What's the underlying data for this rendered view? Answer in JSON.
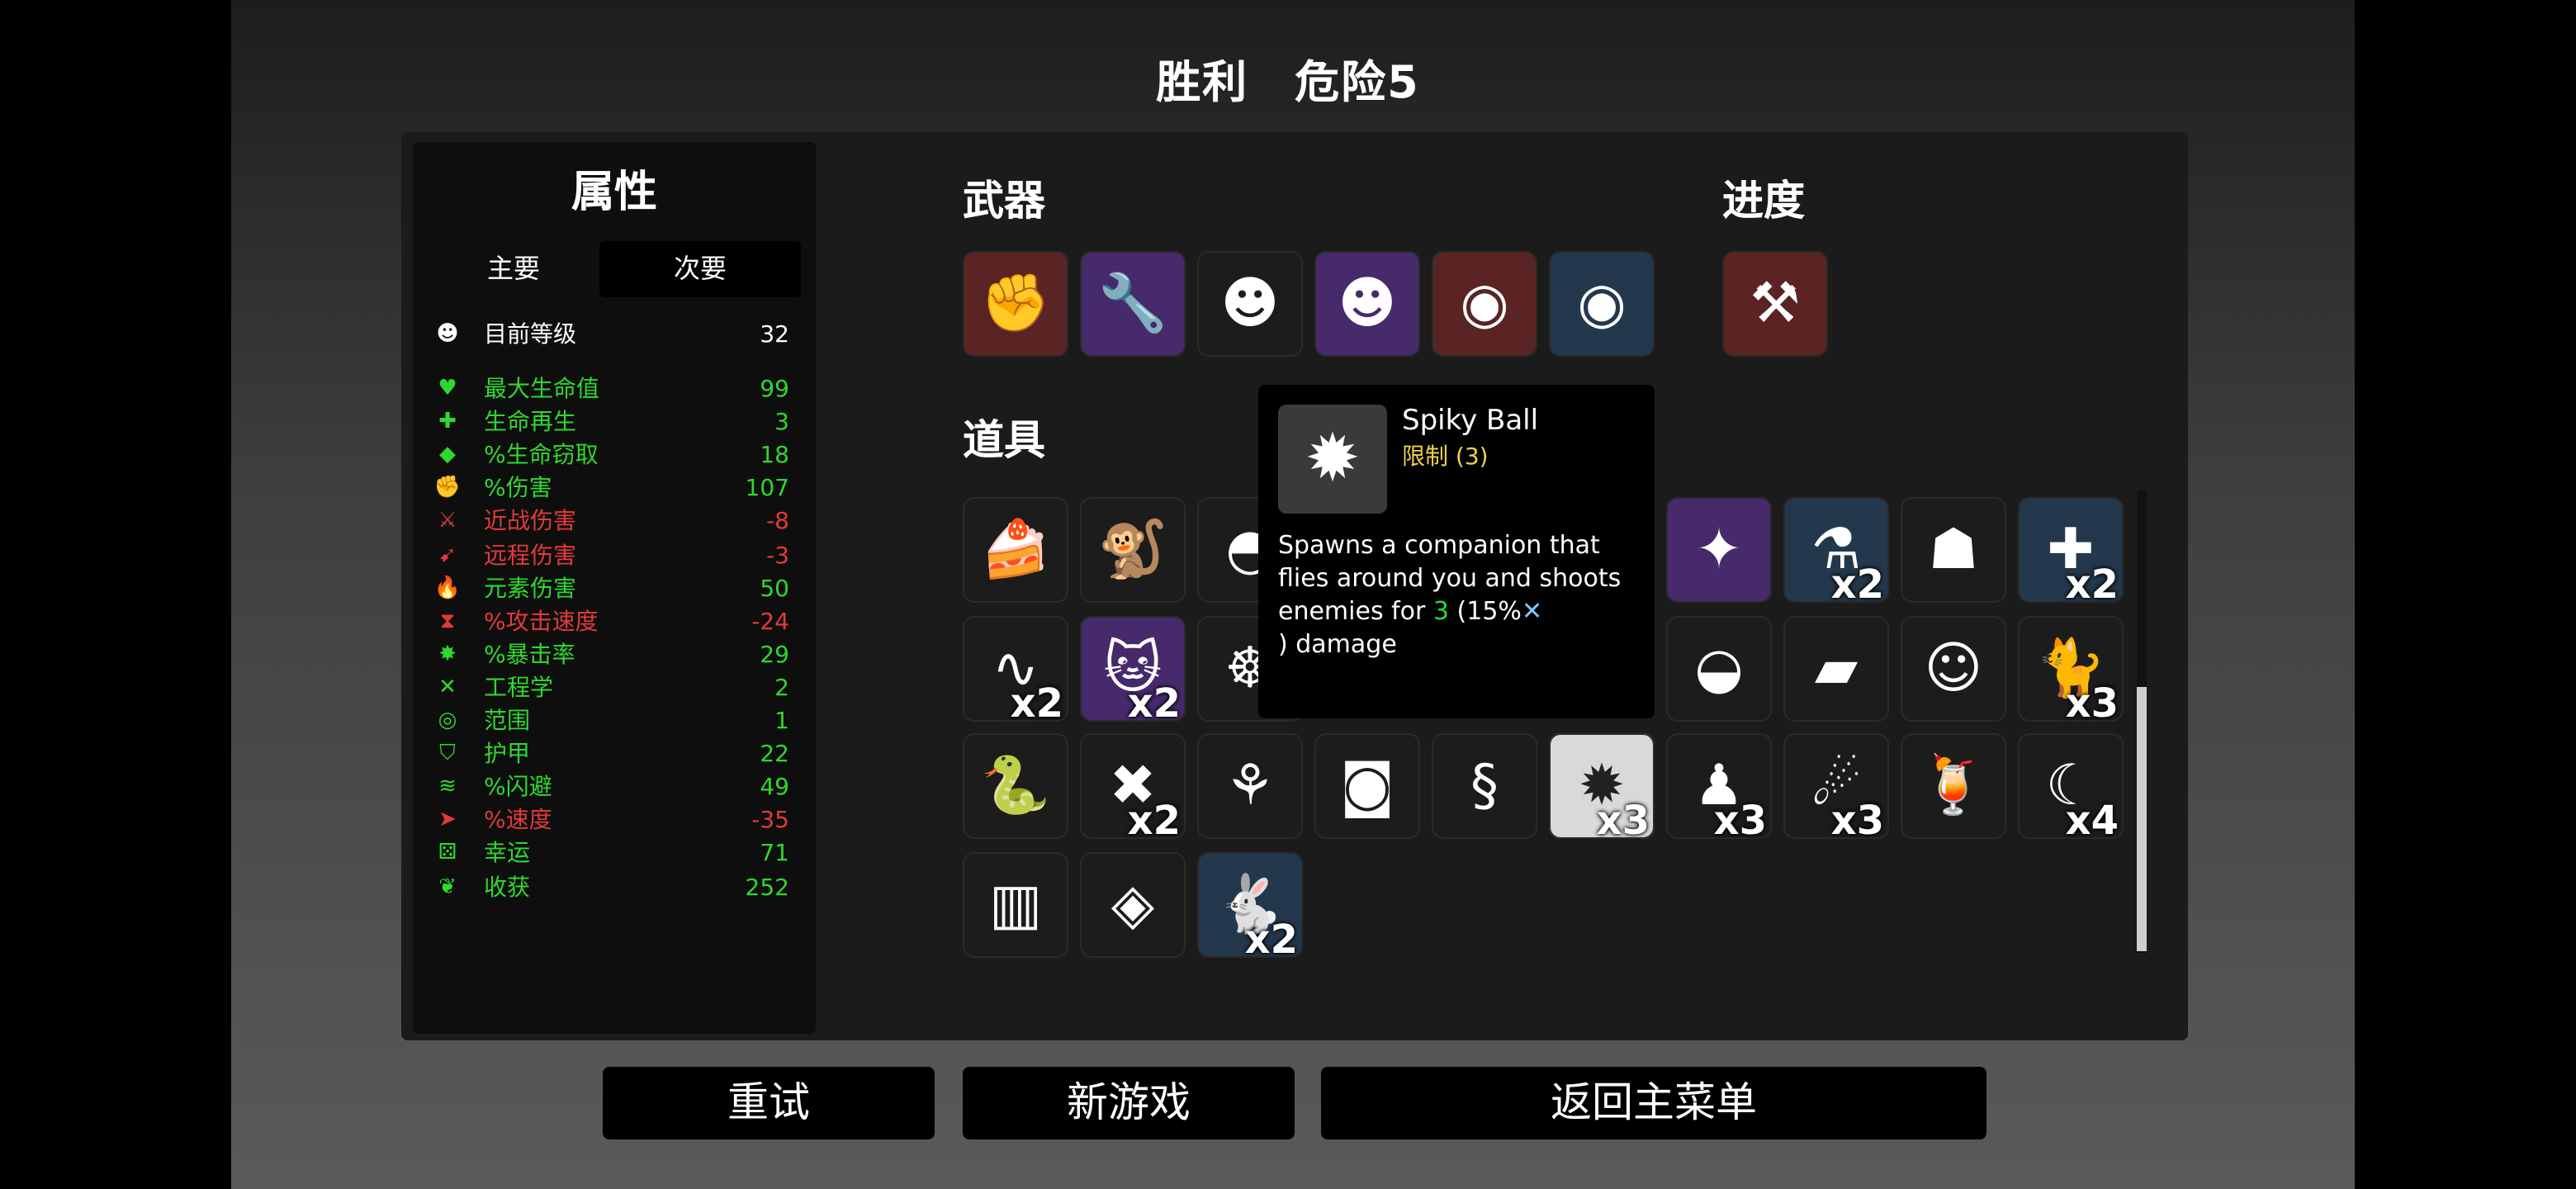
{
  "header": {
    "result": "胜利",
    "danger": "危险5"
  },
  "stats": {
    "title": "属性",
    "tabs": {
      "primary": "主要",
      "secondary": "次要"
    },
    "level": {
      "label": "目前等级",
      "value": "32"
    },
    "rows": [
      {
        "label": "最大生命值",
        "value": "99",
        "color": "g",
        "icon": "♥"
      },
      {
        "label": "生命再生",
        "value": "3",
        "color": "g",
        "icon": "✚"
      },
      {
        "label": "%生命窃取",
        "value": "18",
        "color": "g",
        "icon": "◆"
      },
      {
        "label": "%伤害",
        "value": "107",
        "color": "g",
        "icon": "✊"
      },
      {
        "label": "近战伤害",
        "value": "-8",
        "color": "r",
        "icon": "⚔"
      },
      {
        "label": "远程伤害",
        "value": "-3",
        "color": "r",
        "icon": "➹"
      },
      {
        "label": "元素伤害",
        "value": "50",
        "color": "g",
        "icon": "🔥"
      },
      {
        "label": "%攻击速度",
        "value": "-24",
        "color": "r",
        "icon": "⧗"
      },
      {
        "label": "%暴击率",
        "value": "29",
        "color": "g",
        "icon": "✸"
      },
      {
        "label": "工程学",
        "value": "2",
        "color": "g",
        "icon": "✕"
      },
      {
        "label": "范围",
        "value": "1",
        "color": "g",
        "icon": "◎"
      },
      {
        "label": "护甲",
        "value": "22",
        "color": "g",
        "icon": "⛉"
      },
      {
        "label": "%闪避",
        "value": "49",
        "color": "g",
        "icon": "≋"
      },
      {
        "label": "%速度",
        "value": "-35",
        "color": "r",
        "icon": "➤"
      },
      {
        "label": "幸运",
        "value": "71",
        "color": "g",
        "icon": "⚄"
      },
      {
        "label": "收获",
        "value": "252",
        "color": "g",
        "icon": "❦"
      }
    ]
  },
  "sections": {
    "weapons": "武器",
    "progress": "进度",
    "items": "道具"
  },
  "weapons": [
    {
      "name": "power-fist",
      "glyph": "✊",
      "tier": "red"
    },
    {
      "name": "wrench",
      "glyph": "🔧",
      "tier": "purple"
    },
    {
      "name": "pruner-ghost",
      "glyph": "☻",
      "tier": "plain"
    },
    {
      "name": "pruner-ghost",
      "glyph": "☻",
      "tier": "purple"
    },
    {
      "name": "eye-tome",
      "glyph": "◉",
      "tier": "red"
    },
    {
      "name": "eye-tome",
      "glyph": "◉",
      "tier": "blue"
    }
  ],
  "progress_items": [
    {
      "name": "anvil",
      "glyph": "⚒",
      "tier": "red"
    }
  ],
  "items": [
    [
      {
        "name": "cake",
        "glyph": "🍰",
        "tier": "plain",
        "count": ""
      },
      {
        "name": "monkey",
        "glyph": "🐒",
        "tier": "plain",
        "count": ""
      },
      {
        "name": "helmet",
        "glyph": "◓",
        "tier": "plain",
        "count": ""
      },
      {
        "name": "hidden",
        "glyph": "",
        "tier": "plain",
        "count": ""
      },
      {
        "name": "hidden",
        "glyph": "",
        "tier": "plain",
        "count": ""
      },
      {
        "name": "hidden",
        "glyph": "",
        "tier": "plain",
        "count": ""
      },
      {
        "name": "golden-box",
        "glyph": "✦",
        "tier": "purple",
        "count": ""
      },
      {
        "name": "potion",
        "glyph": "⚗",
        "tier": "blue",
        "count": "x2"
      },
      {
        "name": "ghost-hood",
        "glyph": "☗",
        "tier": "plain",
        "count": ""
      },
      {
        "name": "medic-pack",
        "glyph": "✚",
        "tier": "blue",
        "count": "x2"
      }
    ],
    [
      {
        "name": "tentacle",
        "glyph": "∿",
        "tier": "plain",
        "count": "x2"
      },
      {
        "name": "cat",
        "glyph": "🐱",
        "tier": "purple",
        "count": "x2"
      },
      {
        "name": "turret",
        "glyph": "☸",
        "tier": "plain",
        "count": ""
      },
      {
        "name": "hidden",
        "glyph": "",
        "tier": "plain",
        "count": ""
      },
      {
        "name": "hidden",
        "glyph": "",
        "tier": "plain",
        "count": ""
      },
      {
        "name": "hidden",
        "glyph": "",
        "tier": "plain",
        "count": ""
      },
      {
        "name": "propeller-hat",
        "glyph": "◒",
        "tier": "plain",
        "count": ""
      },
      {
        "name": "book",
        "glyph": "▰",
        "tier": "plain",
        "count": ""
      },
      {
        "name": "ghost",
        "glyph": "☺",
        "tier": "plain",
        "count": ""
      },
      {
        "name": "black-cat",
        "glyph": "🐈",
        "tier": "plain",
        "count": "x3"
      }
    ],
    [
      {
        "name": "snake",
        "glyph": "🐍",
        "tier": "plain",
        "count": ""
      },
      {
        "name": "bat",
        "glyph": "✖",
        "tier": "plain",
        "count": "x2"
      },
      {
        "name": "sprout",
        "glyph": "⚘",
        "tier": "plain",
        "count": ""
      },
      {
        "name": "camera-drone",
        "glyph": "◙",
        "tier": "plain",
        "count": ""
      },
      {
        "name": "worm",
        "glyph": "§",
        "tier": "plain",
        "count": ""
      },
      {
        "name": "spiky-ball",
        "glyph": "✹",
        "tier": "white",
        "count": "x3"
      },
      {
        "name": "scarecrow",
        "glyph": "♟",
        "tier": "plain",
        "count": "x3"
      },
      {
        "name": "sausage",
        "glyph": "☄",
        "tier": "plain",
        "count": "x3"
      },
      {
        "name": "cocktail",
        "glyph": "🍹",
        "tier": "plain",
        "count": ""
      },
      {
        "name": "claw",
        "glyph": "☾",
        "tier": "plain",
        "count": "x4"
      }
    ],
    [
      {
        "name": "jacket",
        "glyph": "▥",
        "tier": "plain",
        "count": ""
      },
      {
        "name": "banknote",
        "glyph": "◈",
        "tier": "plain",
        "count": ""
      },
      {
        "name": "rabbit",
        "glyph": "🐇",
        "tier": "blue",
        "count": "x2"
      }
    ]
  ],
  "tooltip": {
    "name": "Spiky Ball",
    "limit": "限制 (3)",
    "desc_before": "Spawns a companion that flies around you and shoots enemies for ",
    "desc_value": "3",
    "desc_pct": " (15%",
    "desc_after": ") damage",
    "value_color": "#2ed82e"
  },
  "buttons": {
    "retry": "重试",
    "new_game": "新游戏",
    "main_menu": "返回主菜单"
  }
}
